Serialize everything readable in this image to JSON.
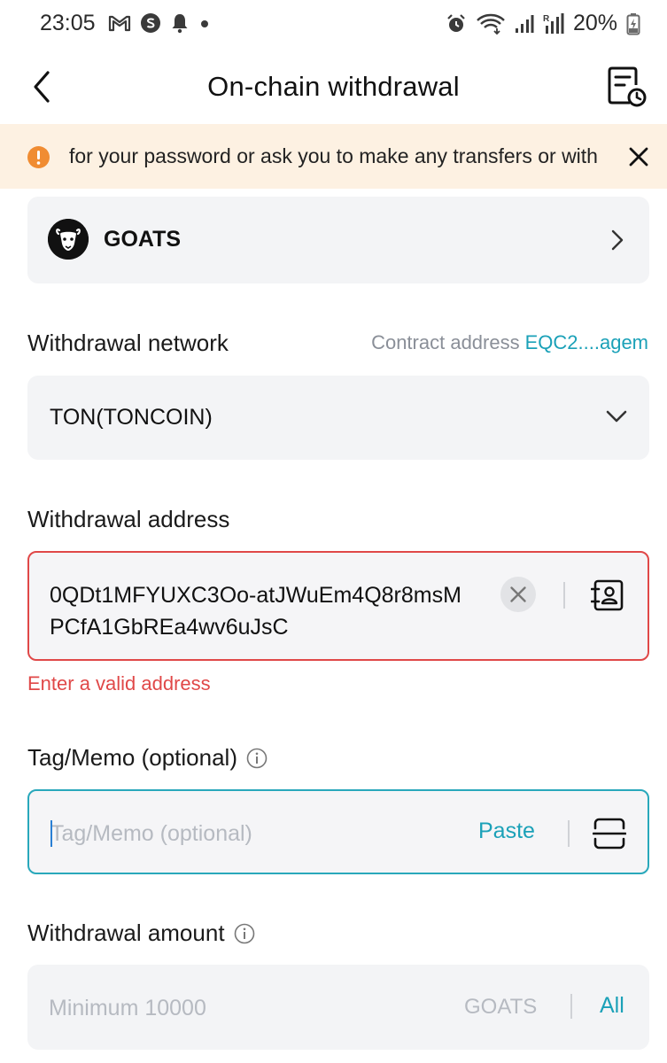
{
  "status_bar": {
    "time": "23:05",
    "battery_percent": "20%",
    "icons_left": [
      "gmail-icon",
      "s-app-icon",
      "notification-bell-icon",
      "dot-icon"
    ],
    "icons_right": [
      "alarm-icon",
      "wifi-icon",
      "signal-icon",
      "signal-roaming-icon",
      "battery-charging-icon"
    ]
  },
  "header": {
    "title": "On-chain withdrawal",
    "back_icon": "chevron-left-icon",
    "history_icon": "document-history-icon"
  },
  "banner": {
    "text": "for your password or ask you to make any transfers or with",
    "icon": "warning-icon",
    "color": "#fdf1e2",
    "accent": "#f08c32"
  },
  "coin": {
    "name": "GOATS",
    "logo_icon": "goat-logo-icon"
  },
  "network": {
    "label": "Withdrawal network",
    "contract_label": "Contract address",
    "contract_value": "EQC2....agem",
    "selected": "TON(TONCOIN)"
  },
  "address": {
    "label": "Withdrawal address",
    "value": "0QDt1MFYUXC3Oo-atJWuEm4Q8r8msMPCfA1GbREa4wv6uJsC",
    "error": "Enter a valid address",
    "error_color": "#e04848"
  },
  "tag": {
    "label": "Tag/Memo (optional)",
    "placeholder": "Tag/Memo (optional)",
    "paste_label": "Paste",
    "focus_color": "#29a8bb"
  },
  "amount": {
    "label": "Withdrawal amount",
    "placeholder": "Minimum 10000",
    "unit": "GOATS",
    "all_label": "All"
  },
  "colors": {
    "accent": "#1ba1b8",
    "field_bg": "#f3f4f6"
  }
}
